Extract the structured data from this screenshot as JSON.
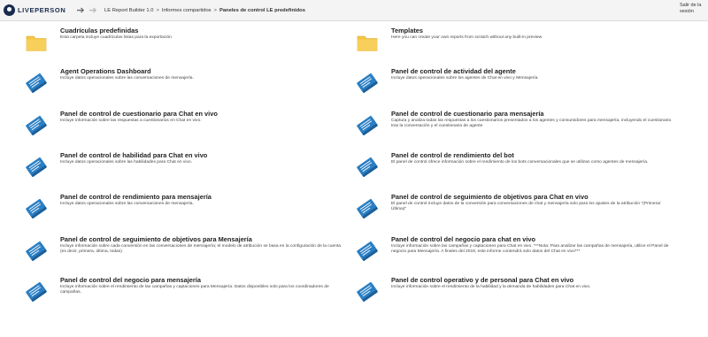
{
  "header": {
    "logo_text": "LIVEPERSON",
    "breadcrumb": [
      "LE Report Builder 1.0",
      "Informes compartidos",
      "Paneles de control LE predefinidos"
    ],
    "signout_label": "Salir de la sesión"
  },
  "colors": {
    "folder": "#f4c542",
    "report": "#2a7fc4",
    "brand": "#1a2c4e"
  },
  "items_left": [
    {
      "type": "folder",
      "title": "Cuadrículas predefinidas",
      "desc": "Esta carpeta incluye cuadrículas listas para la exportación"
    },
    {
      "type": "report",
      "title": "Agent Operations Dashboard",
      "desc": "Incluye datos operacionales sobre las conversaciones de mensajería."
    },
    {
      "type": "report",
      "title": "Panel de control de cuestionario para Chat en vivo",
      "desc": "Incluye información sobre las respuestas a cuestionarios en Chat en vivo."
    },
    {
      "type": "report",
      "title": "Panel de control de habilidad para Chat en vivo",
      "desc": "Incluye datos operacionales sobre las habilidades para Chat en vivo."
    },
    {
      "type": "report",
      "title": "Panel de control de rendimiento para mensajería",
      "desc": "Incluye datos operacionales sobre las conversaciones de mensajería."
    },
    {
      "type": "report",
      "title": "Panel de control de seguimiento de objetivos para Mensajería",
      "desc": "Incluye información sobre cada conversión en las conversaciones de mensajería; el modelo de atribución se basa en la configuración de la cuenta (es decir, primera, última, todas)"
    },
    {
      "type": "report",
      "title": "Panel de control del negocio para mensajería",
      "desc": "Incluye información sobre el rendimiento de las campañas y captaciones para Mensajería. Datos disponibles solo para los coordinadores de campañas."
    }
  ],
  "items_right": [
    {
      "type": "folder",
      "title": "Templates",
      "desc": "Here you can create your own reports from scratch without any built-in preview"
    },
    {
      "type": "report",
      "title": "Panel de control de actividad del agente",
      "desc": "Incluye datos operacionales sobre los agentes de Chat en vivo y Mensajería."
    },
    {
      "type": "report",
      "title": "Panel de control de cuestionario para mensajería",
      "desc": "Captura y analiza todas las respuestas a los cuestionarios presentados a los agentes y consumidores para mensajería, incluyendo el cuestionario tras la conversación y el cuestionario de agente"
    },
    {
      "type": "report",
      "title": "Panel de control de rendimiento del bot",
      "desc": "El panel de control ofrece información sobre el rendimiento de los bots conversacionales que se utilizan como agentes de mensajería."
    },
    {
      "type": "report",
      "title": "Panel de control de seguimiento de objetivos para Chat en vivo",
      "desc": "El panel de control incluye datos de la conversión para conversaciones de chat y mensajería solo para los ajustes de la atribución \"(Primera/Última)\""
    },
    {
      "type": "report",
      "title": "Panel de control del negocio para chat en vivo",
      "desc": "Incluye información sobre las campañas y captaciones para Chat en vivo. ***Nota: Para analizar las campañas de mensajería, utilice el Panel de negocio para Mensajería. A finales del 2019, este informe contendrá solo datos del Chat en vivo***"
    },
    {
      "type": "report",
      "title": "Panel de control operativo y de personal para Chat en vivo",
      "desc": "Incluye información sobre el rendimiento de la habilidad y la demanda de habilidades para Chat en vivo."
    }
  ]
}
